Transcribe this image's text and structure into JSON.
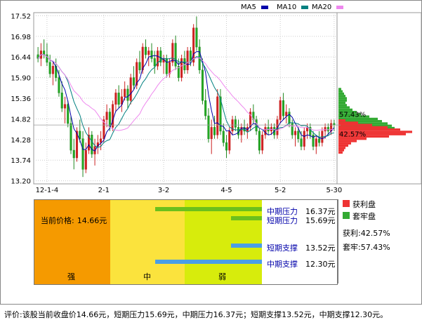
{
  "chart_data": {
    "type": "candlestick",
    "y_ticks": [
      "17.52",
      "16.98",
      "16.44",
      "15.90",
      "15.36",
      "14.82",
      "14.28",
      "13.74",
      "13.20"
    ],
    "y_values": [
      17.52,
      16.98,
      16.44,
      15.9,
      15.36,
      14.82,
      14.28,
      13.74,
      13.2
    ],
    "ylim": [
      13.12,
      17.6
    ],
    "x_ticks": [
      "12-1-4",
      "2-1",
      "3-2",
      "4-5",
      "5-2",
      "5-30"
    ],
    "x_tick_index": [
      3,
      22,
      42,
      63,
      81,
      99
    ],
    "series_ma": [
      {
        "name": "MA5",
        "color": "#0000aa"
      },
      {
        "name": "MA10",
        "color": "#008080"
      },
      {
        "name": "MA20",
        "color": "#ee88ee"
      }
    ],
    "candles": [
      [
        16.5,
        16.7,
        16.3,
        16.4
      ],
      [
        16.4,
        16.8,
        16.2,
        16.6
      ],
      [
        16.6,
        16.9,
        16.4,
        16.5
      ],
      [
        16.5,
        16.8,
        16.2,
        16.3
      ],
      [
        16.3,
        16.5,
        15.9,
        16.0
      ],
      [
        16.0,
        16.3,
        15.7,
        16.2
      ],
      [
        16.2,
        16.4,
        15.8,
        15.9
      ],
      [
        15.9,
        16.1,
        15.4,
        15.5
      ],
      [
        15.5,
        15.8,
        15.0,
        15.1
      ],
      [
        15.1,
        15.4,
        14.7,
        15.2
      ],
      [
        15.2,
        15.3,
        14.6,
        14.7
      ],
      [
        14.7,
        14.9,
        13.9,
        14.0
      ],
      [
        14.0,
        14.3,
        13.5,
        13.8
      ],
      [
        13.8,
        14.6,
        13.7,
        14.5
      ],
      [
        14.5,
        14.8,
        14.2,
        14.3
      ],
      [
        14.3,
        14.5,
        13.3,
        13.5
      ],
      [
        13.5,
        14.2,
        13.4,
        14.0
      ],
      [
        14.0,
        14.6,
        13.9,
        14.4
      ],
      [
        14.4,
        14.5,
        13.8,
        13.9
      ],
      [
        13.9,
        14.3,
        13.6,
        14.1
      ],
      [
        14.1,
        14.4,
        13.9,
        14.2
      ],
      [
        14.2,
        14.5,
        14.0,
        14.3
      ],
      [
        14.3,
        14.9,
        14.2,
        14.8
      ],
      [
        14.8,
        15.2,
        14.6,
        15.0
      ],
      [
        15.0,
        15.1,
        14.5,
        14.6
      ],
      [
        14.6,
        15.3,
        14.5,
        15.2
      ],
      [
        15.2,
        15.6,
        15.0,
        15.5
      ],
      [
        15.5,
        15.7,
        15.1,
        15.2
      ],
      [
        15.2,
        15.6,
        15.0,
        15.4
      ],
      [
        15.4,
        15.8,
        15.3,
        15.6
      ],
      [
        15.6,
        15.7,
        15.1,
        15.3
      ],
      [
        15.3,
        16.0,
        15.2,
        15.9
      ],
      [
        15.9,
        16.2,
        15.6,
        15.7
      ],
      [
        15.7,
        16.4,
        15.6,
        16.3
      ],
      [
        16.3,
        16.6,
        16.0,
        16.1
      ],
      [
        16.1,
        16.8,
        16.0,
        16.7
      ],
      [
        16.7,
        16.9,
        16.4,
        16.5
      ],
      [
        16.5,
        16.7,
        16.2,
        16.6
      ],
      [
        16.6,
        16.8,
        16.3,
        16.4
      ],
      [
        16.4,
        16.6,
        16.0,
        16.2
      ],
      [
        16.2,
        16.7,
        16.1,
        16.6
      ],
      [
        16.6,
        16.7,
        16.2,
        16.3
      ],
      [
        16.3,
        16.5,
        16.0,
        16.4
      ],
      [
        16.4,
        16.5,
        15.9,
        16.0
      ],
      [
        16.0,
        16.4,
        15.9,
        16.3
      ],
      [
        16.3,
        16.9,
        16.2,
        16.8
      ],
      [
        16.8,
        17.0,
        16.1,
        16.2
      ],
      [
        16.2,
        16.4,
        15.8,
        15.9
      ],
      [
        15.9,
        16.5,
        15.8,
        16.4
      ],
      [
        16.4,
        16.6,
        16.0,
        16.1
      ],
      [
        16.1,
        16.7,
        16.0,
        16.6
      ],
      [
        16.6,
        16.7,
        16.2,
        16.3
      ],
      [
        16.3,
        17.3,
        16.2,
        17.2
      ],
      [
        17.2,
        17.5,
        16.6,
        16.7
      ],
      [
        16.7,
        16.9,
        16.0,
        16.1
      ],
      [
        16.1,
        16.4,
        15.2,
        15.3
      ],
      [
        15.3,
        15.6,
        14.8,
        14.9
      ],
      [
        14.9,
        15.1,
        14.2,
        14.3
      ],
      [
        14.3,
        14.8,
        13.9,
        14.6
      ],
      [
        14.6,
        14.9,
        14.3,
        14.4
      ],
      [
        14.4,
        15.6,
        14.3,
        15.4
      ],
      [
        15.4,
        15.6,
        14.4,
        14.5
      ],
      [
        14.5,
        14.7,
        14.1,
        14.2
      ],
      [
        14.2,
        14.4,
        13.8,
        14.0
      ],
      [
        14.0,
        14.6,
        13.9,
        14.5
      ],
      [
        14.5,
        14.9,
        14.4,
        14.8
      ],
      [
        14.8,
        14.9,
        14.5,
        14.6
      ],
      [
        14.6,
        14.8,
        14.3,
        14.4
      ],
      [
        14.4,
        14.7,
        14.2,
        14.6
      ],
      [
        14.6,
        14.8,
        14.4,
        14.5
      ],
      [
        14.5,
        14.7,
        14.3,
        14.6
      ],
      [
        14.6,
        15.1,
        14.5,
        15.0
      ],
      [
        15.0,
        15.2,
        14.7,
        14.8
      ],
      [
        14.8,
        14.9,
        14.4,
        14.5
      ],
      [
        14.5,
        14.6,
        13.9,
        14.0
      ],
      [
        14.0,
        14.5,
        13.9,
        14.4
      ],
      [
        14.4,
        14.7,
        14.3,
        14.6
      ],
      [
        14.6,
        14.8,
        14.4,
        14.5
      ],
      [
        14.5,
        14.7,
        14.4,
        14.6
      ],
      [
        14.6,
        14.7,
        14.3,
        14.4
      ],
      [
        14.4,
        14.9,
        14.3,
        14.8
      ],
      [
        14.8,
        15.4,
        14.7,
        15.3
      ],
      [
        15.3,
        15.5,
        14.8,
        14.9
      ],
      [
        14.9,
        15.2,
        14.7,
        15.0
      ],
      [
        15.0,
        15.1,
        14.6,
        14.7
      ],
      [
        14.7,
        14.8,
        14.3,
        14.4
      ],
      [
        14.4,
        14.6,
        14.1,
        14.5
      ],
      [
        14.5,
        14.6,
        14.2,
        14.3
      ],
      [
        14.3,
        14.5,
        14.0,
        14.1
      ],
      [
        14.1,
        14.6,
        14.0,
        14.5
      ],
      [
        14.5,
        14.7,
        14.3,
        14.6
      ],
      [
        14.6,
        14.7,
        14.3,
        14.4
      ],
      [
        14.4,
        14.5,
        14.0,
        14.1
      ],
      [
        14.1,
        14.4,
        13.9,
        14.3
      ],
      [
        14.3,
        14.5,
        14.1,
        14.2
      ],
      [
        14.2,
        14.6,
        14.1,
        14.5
      ],
      [
        14.5,
        14.7,
        14.3,
        14.6
      ],
      [
        14.6,
        14.7,
        14.4,
        14.5
      ],
      [
        14.5,
        14.8,
        14.4,
        14.7
      ],
      [
        14.7,
        14.8,
        14.5,
        14.66
      ]
    ],
    "distribution": {
      "profit_color": "#ee3333",
      "locked_color": "#33aa33",
      "bands_profit": [
        {
          "price": 14.78,
          "w": 10
        },
        {
          "price": 14.72,
          "w": 28
        },
        {
          "price": 14.66,
          "w": 48
        },
        {
          "price": 14.6,
          "w": 70
        },
        {
          "price": 14.54,
          "w": 88
        },
        {
          "price": 14.48,
          "w": 105
        },
        {
          "price": 14.42,
          "w": 96
        },
        {
          "price": 14.36,
          "w": 72
        },
        {
          "price": 14.3,
          "w": 40
        },
        {
          "price": 14.24,
          "w": 26
        },
        {
          "price": 14.18,
          "w": 18
        },
        {
          "price": 14.12,
          "w": 14
        },
        {
          "price": 14.06,
          "w": 10
        },
        {
          "price": 14.0,
          "w": 8
        },
        {
          "price": 13.94,
          "w": 6
        }
      ],
      "bands_locked": [
        {
          "price": 15.6,
          "w": 4
        },
        {
          "price": 15.54,
          "w": 6
        },
        {
          "price": 15.48,
          "w": 8
        },
        {
          "price": 15.42,
          "w": 10
        },
        {
          "price": 15.36,
          "w": 12
        },
        {
          "price": 15.3,
          "w": 12
        },
        {
          "price": 15.24,
          "w": 10
        },
        {
          "price": 15.18,
          "w": 12
        },
        {
          "price": 15.12,
          "w": 16
        },
        {
          "price": 15.06,
          "w": 20
        },
        {
          "price": 15.0,
          "w": 26
        },
        {
          "price": 14.94,
          "w": 32
        },
        {
          "price": 14.88,
          "w": 44
        },
        {
          "price": 14.82,
          "w": 56
        },
        {
          "price": 14.76,
          "w": 62
        },
        {
          "price": 14.7,
          "w": 70
        },
        {
          "price": 14.64,
          "w": 76
        },
        {
          "price": 14.58,
          "w": 80
        }
      ],
      "locked_label": "57.43%",
      "profit_label": "42.57%"
    }
  },
  "legend": {
    "ma5": "MA5",
    "ma10": "MA10",
    "ma20": "MA20"
  },
  "panel": {
    "price_label": "当前价格",
    "price_value": "14.66元",
    "zone_strong": "强",
    "zone_mid": "中",
    "zone_weak": "弱",
    "mid_pressure_label": "中期压力",
    "mid_pressure_value": "16.37元",
    "short_pressure_label": "短期压力",
    "short_pressure_value": "15.69元",
    "short_support_label": "短期支撑",
    "short_support_value": "13.52元",
    "mid_support_label": "中期支撑",
    "mid_support_value": "12.30元",
    "profit_legend": "获利盘",
    "locked_legend": "套牢盘",
    "profit_pct_text": "获利:42.57%",
    "locked_pct_text": "套牢:57.43%",
    "colors": {
      "strong": "#f59a00",
      "mid": "#fbe33d",
      "weak": "#d7ec0c",
      "pressure": "#6cc01c",
      "support": "#4a9ee6"
    }
  },
  "footer": "评价:该股当前收盘价14.66元，短期压力15.69元，中期压力16.37元；短期支撑13.52元，中期支撑12.30元。"
}
